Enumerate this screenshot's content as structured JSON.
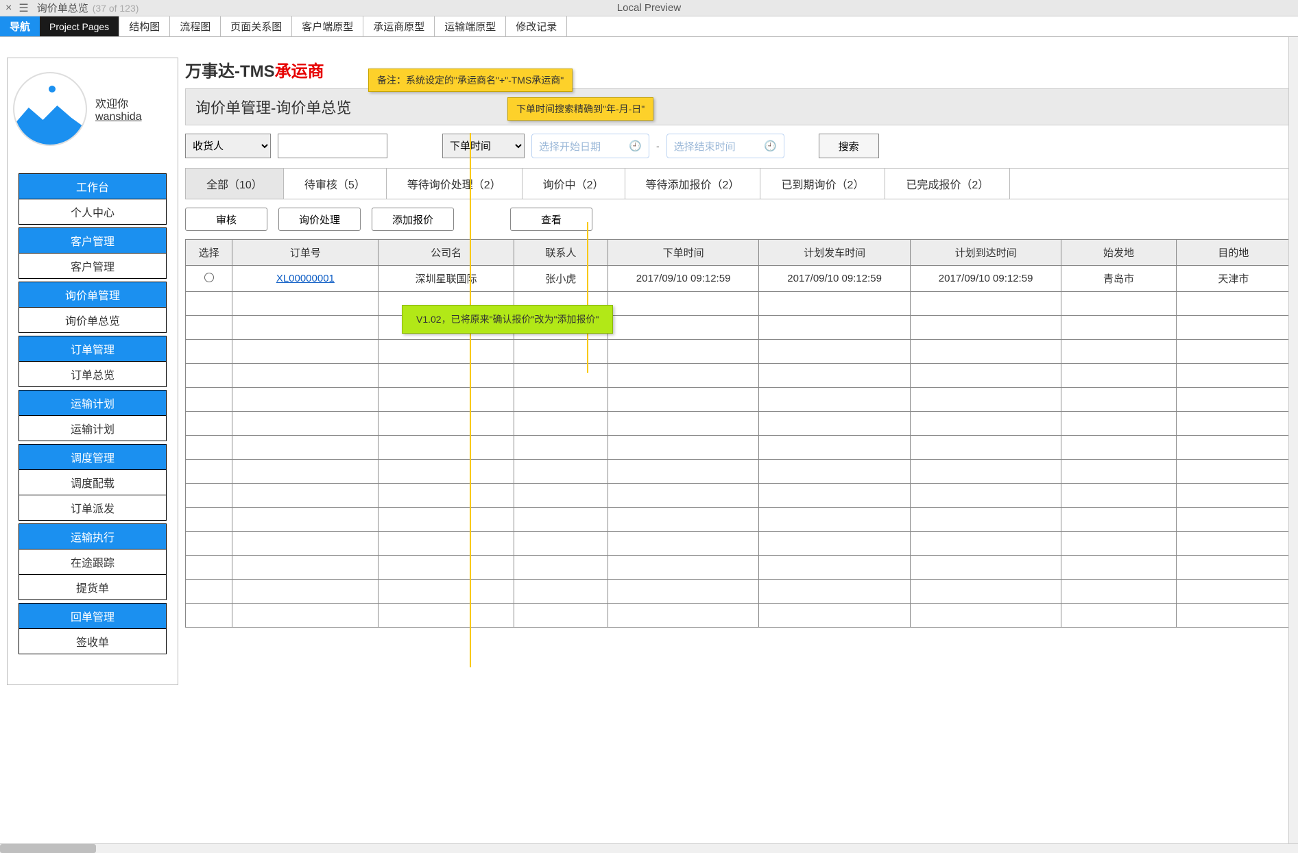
{
  "topbar": {
    "title": "询价单总览",
    "counter": "(37 of 123)",
    "preview": "Local Preview"
  },
  "tabs": [
    "导航",
    "Project Pages",
    "结构图",
    "流程图",
    "页面关系图",
    "客户端原型",
    "承运商原型",
    "运输端原型",
    "修改记录"
  ],
  "avatar": {
    "greet": "欢迎你",
    "user": "wanshida"
  },
  "nav": [
    {
      "hdr": "工作台",
      "items": [
        "个人中心"
      ]
    },
    {
      "hdr": "客户管理",
      "items": [
        "客户管理"
      ]
    },
    {
      "hdr": "询价单管理",
      "items": [
        "询价单总览"
      ]
    },
    {
      "hdr": "订单管理",
      "items": [
        "订单总览"
      ]
    },
    {
      "hdr": "运输计划",
      "items": [
        "运输计划"
      ]
    },
    {
      "hdr": "调度管理",
      "items": [
        "调度配载",
        "订单派发"
      ]
    },
    {
      "hdr": "运输执行",
      "items": [
        "在途跟踪",
        "提货单"
      ]
    },
    {
      "hdr": "回单管理",
      "items": [
        "签收单"
      ]
    }
  ],
  "brand": {
    "black": "万事达-TMS",
    "red": "承运商"
  },
  "pageTitle": "询价单管理-询价单总览",
  "filter": {
    "select1": "收货人",
    "select2": "下单时间",
    "startPh": "选择开始日期",
    "endPh": "选择结束时间",
    "search": "搜索",
    "dash": "-"
  },
  "statusTabs": [
    "全部（10）",
    "待审核（5）",
    "等待询价处理（2）",
    "询价中（2）",
    "等待添加报价（2）",
    "已到期询价（2）",
    "已完成报价（2）"
  ],
  "actions": [
    "审核",
    "询价处理",
    "添加报价",
    "查看"
  ],
  "cols": [
    "选择",
    "订单号",
    "公司名",
    "联系人",
    "下单时间",
    "计划发车时间",
    "计划到达时间",
    "始发地",
    "目的地"
  ],
  "rows": [
    {
      "order": "XL00000001",
      "company": "深圳星联国际",
      "contact": "张小虎",
      "ot": "2017/09/10  09:12:59",
      "dt": "2017/09/10  09:12:59",
      "at": "2017/09/10  09:12:59",
      "from": "青岛市",
      "to": "天津市"
    }
  ],
  "emptyRows": 14,
  "notes": {
    "y1": "备注：系统设定的\"承运商名\"+\"-TMS承运商\"",
    "y2": "下单时间搜索精确到\"年-月-日\"",
    "g": "V1.02，已将原来\"确认报价\"改为\"添加报价\""
  }
}
